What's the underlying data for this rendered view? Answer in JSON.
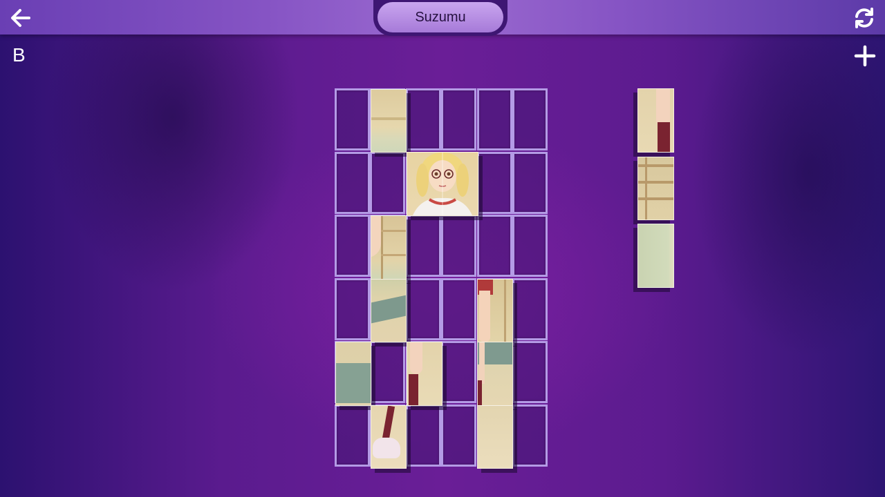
{
  "header": {
    "title": "Suzumu",
    "back_icon": "arrow-left-icon",
    "refresh_icon": "refresh-icon"
  },
  "puzzle": {
    "label": "B",
    "add_icon": "plus-icon",
    "grid": {
      "columns": 6,
      "rows": 6
    },
    "placed_tiles": 11,
    "tray_tiles": 3
  },
  "colors": {
    "topbar": "#8654c4",
    "title_pill": "#b58be3",
    "grid_line": "#b49be6",
    "slot_fill": "#46167380"
  }
}
